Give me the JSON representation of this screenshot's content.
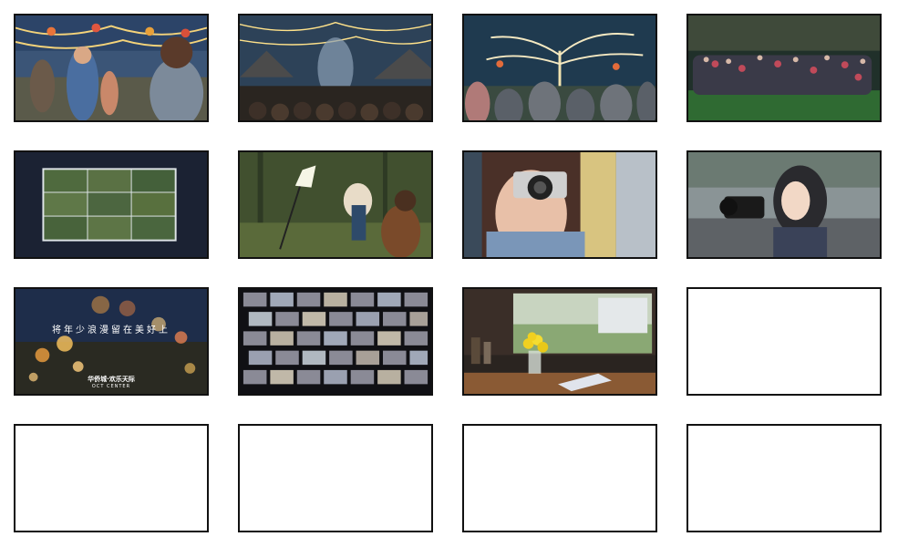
{
  "storyboard": {
    "panels": [
      {
        "id": 1,
        "scene": "illustrated festival crowd under string lights"
      },
      {
        "id": 2,
        "scene": "illustrated night market tents with lights"
      },
      {
        "id": 3,
        "scene": "illustrated glowing tree with crowd"
      },
      {
        "id": 4,
        "scene": "group photo on green lawn"
      },
      {
        "id": 5,
        "scene": "photo collage on dark background"
      },
      {
        "id": 6,
        "scene": "forest photo shoot with lighting"
      },
      {
        "id": 7,
        "scene": "girl holding camera"
      },
      {
        "id": 8,
        "scene": "illustrated girl with camera"
      },
      {
        "id": 9,
        "scene": "bokeh city lights with slogan",
        "slogan": "将年少浪漫留在美好上",
        "logo_cn": "华侨城·欢乐天际",
        "logo_en": "OCT CENTER"
      },
      {
        "id": 10,
        "scene": "mosaic of many portrait photos"
      },
      {
        "id": 11,
        "scene": "window sill with flowers and book"
      },
      {
        "id": 12,
        "scene": "empty"
      },
      {
        "id": 13,
        "scene": "empty"
      },
      {
        "id": 14,
        "scene": "empty"
      },
      {
        "id": 15,
        "scene": "empty"
      },
      {
        "id": 16,
        "scene": "empty"
      }
    ]
  }
}
